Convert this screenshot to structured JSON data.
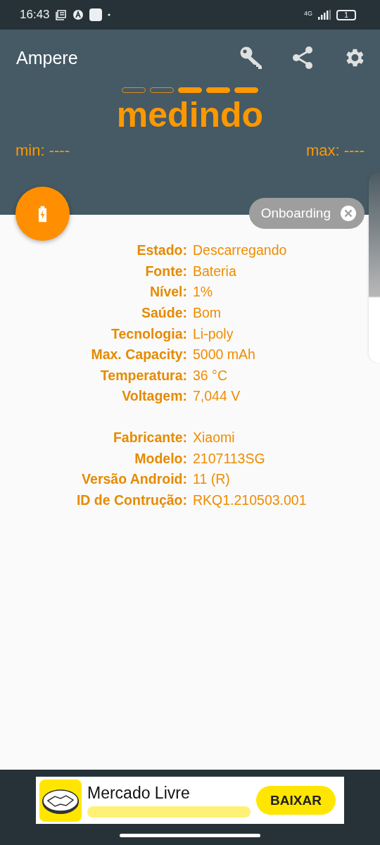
{
  "status_bar": {
    "time": "16:43",
    "network": "4G",
    "battery": "1"
  },
  "app_bar": {
    "title": "Ampere"
  },
  "meter": {
    "segments": [
      {
        "filled": false
      },
      {
        "filled": false
      },
      {
        "filled": true
      },
      {
        "filled": true
      },
      {
        "filled": true
      }
    ],
    "status": "medindo",
    "min": "min: ----",
    "max": "max: ----"
  },
  "chip": {
    "label": "Onboarding"
  },
  "info_groups": [
    [
      {
        "label": "Estado:",
        "value": "Descarregando"
      },
      {
        "label": "Fonte:",
        "value": "Bateria"
      },
      {
        "label": "Nível:",
        "value": "1%"
      },
      {
        "label": "Saúde:",
        "value": "Bom"
      },
      {
        "label": "Tecnologia:",
        "value": "Li-poly"
      },
      {
        "label": "Max. Capacity:",
        "value": "5000 mAh"
      },
      {
        "label": "Temperatura:",
        "value": "36 °C"
      },
      {
        "label": "Voltagem:",
        "value": "7,044 V"
      }
    ],
    [
      {
        "label": "Fabricante:",
        "value": "Xiaomi"
      },
      {
        "label": "Modelo:",
        "value": "2107113SG"
      },
      {
        "label": "Versão Android:",
        "value": "11 (R)"
      },
      {
        "label": "ID de Contrução:",
        "value": "RKQ1.210503.001"
      }
    ]
  ],
  "ad": {
    "title": "Mercado Livre",
    "button": "BAIXAR"
  }
}
